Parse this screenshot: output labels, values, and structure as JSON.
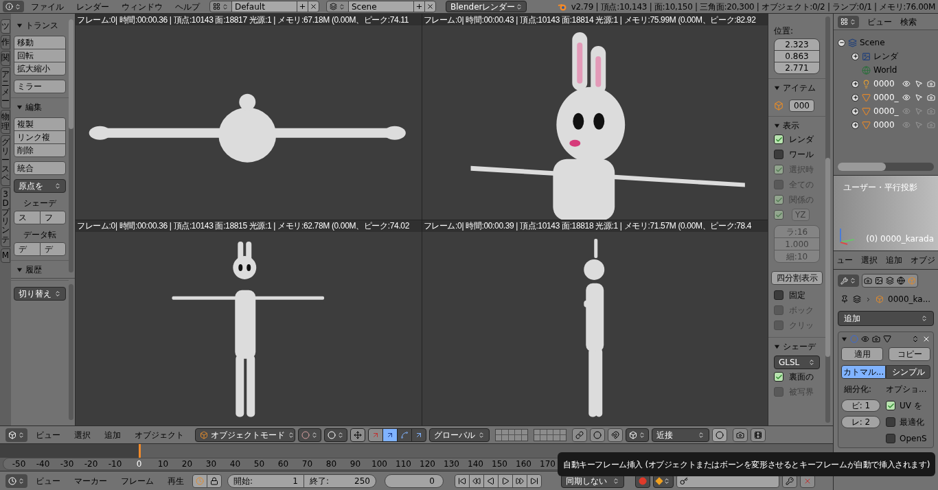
{
  "info_bar": {
    "menus": [
      "ファイル",
      "レンダー",
      "ウィンドウ",
      "ヘルプ"
    ],
    "layout": "Default",
    "scene": "Scene",
    "engine": "Blenderレンダー",
    "stats": "v2.79 | 頂点:10,143 | 面:10,150 | 三角面:20,300 | オブジェクト:0/2 | ランプ:0/1 | メモリ:76.00M"
  },
  "tool_shelf": {
    "tabs": [
      {
        "label": "ツ",
        "selected": true
      },
      {
        "label": "作",
        "selected": false
      },
      {
        "label": "関",
        "selected": false
      },
      {
        "label": "アニメー",
        "selected": false
      },
      {
        "label": "物理",
        "selected": false
      },
      {
        "label": "グリースペ",
        "selected": false
      },
      {
        "label": "3Dプリンテ",
        "selected": false
      },
      {
        "label": "M",
        "selected": false
      }
    ],
    "panels": [
      {
        "title": "トランス",
        "expanded": true,
        "items": [
          {
            "kind": "group",
            "buttons": [
              "移動",
              "回転",
              "拡大縮小"
            ]
          },
          {
            "kind": "group",
            "buttons": [
              "ミラー"
            ]
          }
        ]
      },
      {
        "title": "編集",
        "expanded": true,
        "items": [
          {
            "kind": "group",
            "buttons": [
              "複製",
              "リンク複",
              "削除"
            ]
          },
          {
            "kind": "group",
            "buttons": [
              "統合"
            ]
          },
          {
            "kind": "dropdown",
            "label": "原点を"
          },
          {
            "kind": "label",
            "label": "シェーデ"
          },
          {
            "kind": "row",
            "buttons": [
              "ス",
              "フ"
            ]
          },
          {
            "kind": "label",
            "label": "データ転"
          },
          {
            "kind": "row",
            "buttons": [
              "デ",
              "デ"
            ]
          }
        ]
      },
      {
        "title": "履歴",
        "expanded": true
      }
    ],
    "operator_dropdown": "切り替え"
  },
  "viewports": [
    {
      "kind": "top",
      "stats": "フレーム:0| 時間:00:00.36 | 頂点:10143 面:18817 光源:1 | メモリ:67.18M (0.00M、ピーク:74.11"
    },
    {
      "kind": "closeup",
      "stats": "フレーム:0| 時間:00:00.43 | 頂点:10143 面:18814 光源:1 | メモリ:75.99M (0.00M、ピーク:82.92"
    },
    {
      "kind": "front",
      "stats": "フレーム:0| 時間:00:00.36 | 頂点:10143 面:18815 光源:1 | メモリ:62.78M (0.00M、ピーク:74.02"
    },
    {
      "kind": "side",
      "stats": "フレーム:0| 時間:00:00.39 | 頂点:10143 面:18818 光源:1 | メモリ:71.57M (0.00M、ピーク:78.4"
    }
  ],
  "n_panel": {
    "location_label": "位置:",
    "location": [
      "2.323",
      "0.863",
      "2.771"
    ],
    "sections": [
      {
        "title": "アイテム",
        "items": [
          {
            "kind": "name_field",
            "value": "000"
          }
        ]
      },
      {
        "title": "表示",
        "items": [
          {
            "kind": "checkbox",
            "label": "レンダ",
            "checked": true,
            "disabled": false
          },
          {
            "kind": "checkbox",
            "label": "ワール",
            "checked": false,
            "disabled": false
          },
          {
            "kind": "checkbox",
            "label": "選択時",
            "checked": true,
            "disabled": true
          },
          {
            "kind": "checkbox",
            "label": "全ての",
            "checked": false,
            "disabled": true
          },
          {
            "kind": "checkbox",
            "label": "関係の",
            "checked": true,
            "disabled": true
          },
          {
            "kind": "check_toggle",
            "label": "YZ",
            "checked": true,
            "disabled": true
          },
          {
            "kind": "numbers",
            "values": [
              "ラ:16",
              "1.000",
              "細:10"
            ],
            "disabled": true
          },
          {
            "kind": "button",
            "label": "四分割表示"
          },
          {
            "kind": "checkbox",
            "label": "固定",
            "checked": false,
            "disabled": false
          },
          {
            "kind": "checkbox",
            "label": "ボック",
            "checked": false,
            "disabled": true
          },
          {
            "kind": "checkbox",
            "label": "クリッ",
            "checked": false,
            "disabled": true
          }
        ]
      },
      {
        "title": "シェーデ",
        "items": [
          {
            "kind": "dropdown",
            "label": "GLSL"
          },
          {
            "kind": "checkbox",
            "label": "裏面の",
            "checked": true,
            "disabled": false
          },
          {
            "kind": "checkbox",
            "label": "被写界",
            "checked": false,
            "disabled": true
          }
        ]
      }
    ]
  },
  "outliner": {
    "menus": [
      "ビュー",
      "検索"
    ],
    "tree": [
      {
        "label": "Scene",
        "kind": "scene",
        "expanded": true,
        "children": [
          {
            "label": "レンダ",
            "kind": "render_layers",
            "expanded": false
          },
          {
            "label": "World",
            "kind": "world"
          },
          {
            "label": "0000",
            "kind": "lamp",
            "expanded": false,
            "visible": true
          },
          {
            "label": "0000_",
            "kind": "mesh",
            "expanded": false,
            "visible": true
          },
          {
            "label": "0000_",
            "kind": "mesh",
            "expanded": false,
            "visible": false
          },
          {
            "label": "0000",
            "kind": "mesh",
            "expanded": false,
            "visible": false
          }
        ]
      }
    ]
  },
  "mini_view": {
    "title": "ユーザー・平行投影",
    "object": "(0) 0000_karada",
    "menus": [
      "ュー",
      "選択",
      "追加",
      "オブジ"
    ]
  },
  "properties": {
    "path": "0000_ka...",
    "add_dropdown": "追加",
    "apply": "適用",
    "copy": "コピー",
    "tabs": [
      {
        "label": "カトマル...",
        "selected": true
      },
      {
        "label": "シンプル",
        "selected": false
      }
    ],
    "subdivisions_label": "細分化:",
    "options_label": "オプショ...",
    "fields": [
      "ビ: 1",
      "レ: 2"
    ],
    "options": [
      {
        "label": "UV を",
        "checked": true
      },
      {
        "label": "最適化",
        "checked": false
      },
      {
        "label": "OpenS",
        "checked": false
      }
    ]
  },
  "view3d_header": {
    "menus": [
      "ビュー",
      "選択",
      "追加",
      "オブジェクト"
    ],
    "mode": "オブジェクトモード",
    "orientation": "グローバル",
    "snap": "近接"
  },
  "timeline": {
    "ticks": [
      {
        "label": "-50",
        "current": false
      },
      {
        "label": "-40",
        "current": false
      },
      {
        "label": "-30",
        "current": false
      },
      {
        "label": "-20",
        "current": false
      },
      {
        "label": "-10",
        "current": false
      },
      {
        "label": "0",
        "current": true
      },
      {
        "label": "10",
        "current": false
      },
      {
        "label": "20",
        "current": false
      },
      {
        "label": "30",
        "current": false
      },
      {
        "label": "40",
        "current": false
      },
      {
        "label": "50",
        "current": false
      },
      {
        "label": "60",
        "current": false
      },
      {
        "label": "70",
        "current": false
      },
      {
        "label": "80",
        "current": false
      },
      {
        "label": "90",
        "current": false
      },
      {
        "label": "100",
        "current": false
      },
      {
        "label": "110",
        "current": false
      },
      {
        "label": "120",
        "current": false
      },
      {
        "label": "130",
        "current": false
      },
      {
        "label": "140",
        "current": false
      },
      {
        "label": "150",
        "current": false
      },
      {
        "label": "160",
        "current": false
      },
      {
        "label": "170",
        "current": false
      }
    ]
  },
  "timeline_header": {
    "menus": [
      "ビュー",
      "マーカー",
      "フレーム",
      "再生"
    ],
    "start_label": "開始:",
    "start": "1",
    "end_label": "終了:",
    "end": "250",
    "frame": "0",
    "sync": "同期しない"
  },
  "tooltip": "自動キーフレーム挿入 (オブジェクトまたはボーンを変形させるとキーフレームが自動で挿入されます)"
}
